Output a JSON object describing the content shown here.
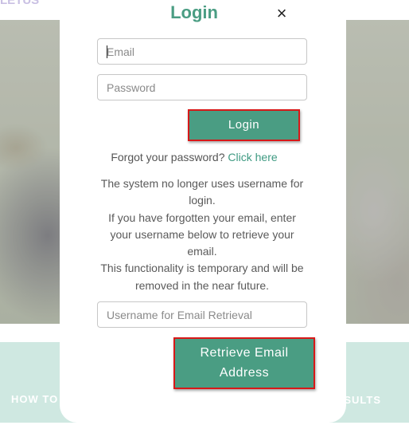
{
  "background": {
    "top_text": "LETUS",
    "band_left": "HOW TO",
    "band_right": "SULTS"
  },
  "modal": {
    "title": "Login",
    "close_symbol": "×",
    "email_placeholder": "Email",
    "password_placeholder": "Password",
    "login_button": "Login",
    "forgot_text": "Forgot your password?",
    "forgot_link": "Click here",
    "info_lines": [
      "The system no longer uses username for login.",
      "If you have forgotten your email, enter your username below to retrieve your email.",
      "This functionality is temporary and will be removed in the near future."
    ],
    "username_placeholder": "Username for Email Retrieval",
    "retrieve_button_line1": "Retrieve Email",
    "retrieve_button_line2": "Address"
  },
  "colors": {
    "accent": "#4a9d83",
    "highlight_border": "#d81818",
    "band": "#cfe8e1"
  },
  "icons": {
    "close": "close-icon"
  }
}
